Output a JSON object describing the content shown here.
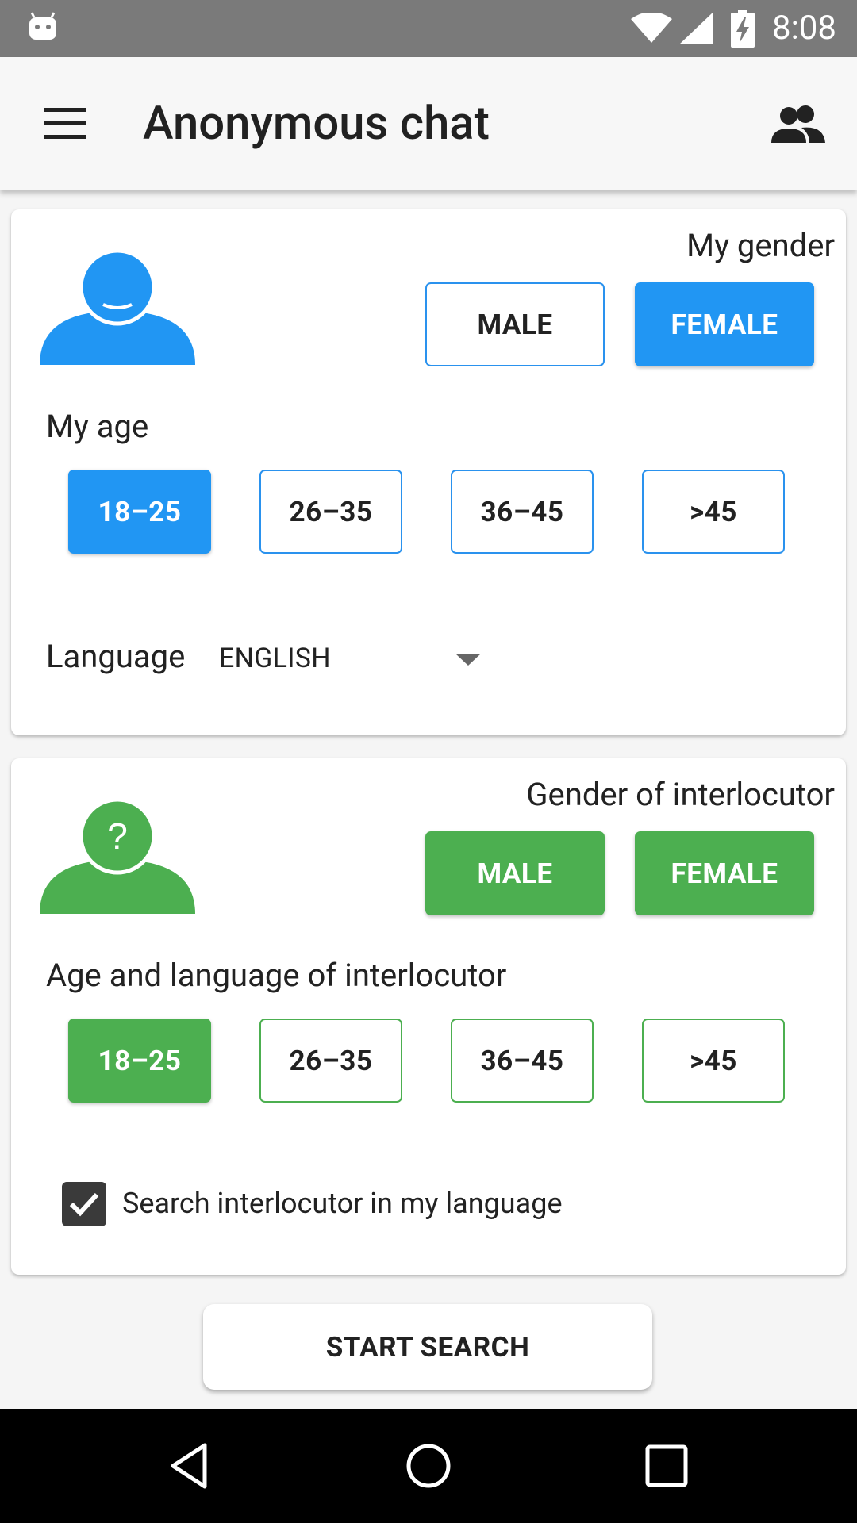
{
  "status_bar": {
    "time": "8:08"
  },
  "app_bar": {
    "title": "Anonymous chat"
  },
  "my_profile": {
    "gender_label": "My gender",
    "gender_options": [
      "MALE",
      "FEMALE"
    ],
    "age_label": "My age",
    "age_options": [
      "18–25",
      "26–35",
      "36–45",
      ">45"
    ],
    "language_label": "Language",
    "language_value": "ENGLISH",
    "avatar_color": "#2196f3"
  },
  "interlocutor": {
    "gender_label": "Gender of interlocutor",
    "gender_options": [
      "MALE",
      "FEMALE"
    ],
    "age_label": "Age and language of interlocutor",
    "age_options": [
      "18–25",
      "26–35",
      "36–45",
      ">45"
    ],
    "same_language_label": "Search interlocutor in my language",
    "same_language_checked": true,
    "avatar_symbol": "?",
    "avatar_color": "#4caf50"
  },
  "actions": {
    "start_label": "START SEARCH"
  },
  "colors": {
    "accent_blue": "#2196f3",
    "accent_green": "#4caf50",
    "status_bar": "#7a7a7a"
  }
}
